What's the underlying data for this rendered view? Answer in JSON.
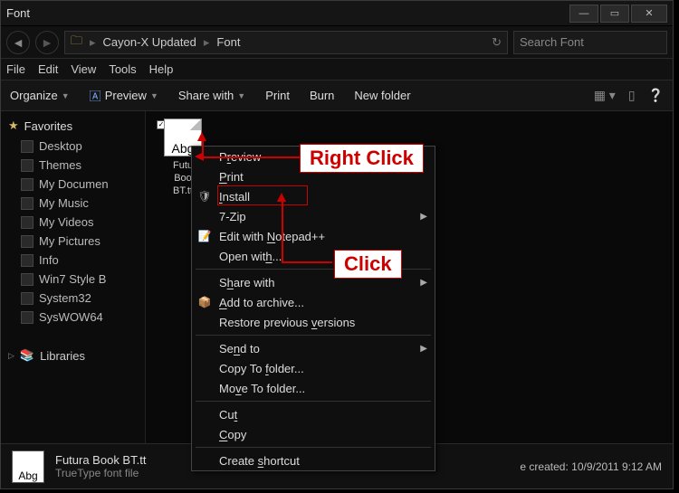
{
  "window": {
    "title": "Font"
  },
  "nav": {
    "path": [
      "Cayon-X Updated",
      "Font"
    ],
    "search_placeholder": "Search Font"
  },
  "menubar": [
    "File",
    "Edit",
    "View",
    "Tools",
    "Help"
  ],
  "toolbar": {
    "organize": "Organize",
    "preview": "Preview",
    "share": "Share with",
    "print": "Print",
    "burn": "Burn",
    "newfolder": "New folder"
  },
  "sidebar": {
    "favorites_label": "Favorites",
    "items": [
      "Desktop",
      "Themes",
      "My Documen",
      "My Music",
      "My Videos",
      "My Pictures",
      "Info",
      "Win7 Style B",
      "System32",
      "SysWOW64"
    ],
    "libraries_label": "Libraries"
  },
  "file": {
    "glyph": "Abg",
    "name_lines": [
      "Futu",
      "Boo",
      "BT.tt"
    ]
  },
  "context_menu": {
    "preview": "Preview",
    "print": "Print",
    "install": "Install",
    "sevenzip": "7-Zip",
    "editnpp": "Edit with Notepad++",
    "openwith": "Open with...",
    "sharewith": "Share with",
    "addarchive": "Add to archive...",
    "restore": "Restore previous versions",
    "sendto": "Send to",
    "copyto": "Copy To folder...",
    "moveto": "Move To folder...",
    "cut": "Cut",
    "copy": "Copy",
    "shortcut": "Create shortcut"
  },
  "annotations": {
    "right_click": "Right Click",
    "click": "Click"
  },
  "details": {
    "glyph": "Abg",
    "name": "Futura Book BT.tt",
    "type": "TrueType font file",
    "date_label": "e created:",
    "date_value": "10/9/2011 9:12 AM"
  }
}
